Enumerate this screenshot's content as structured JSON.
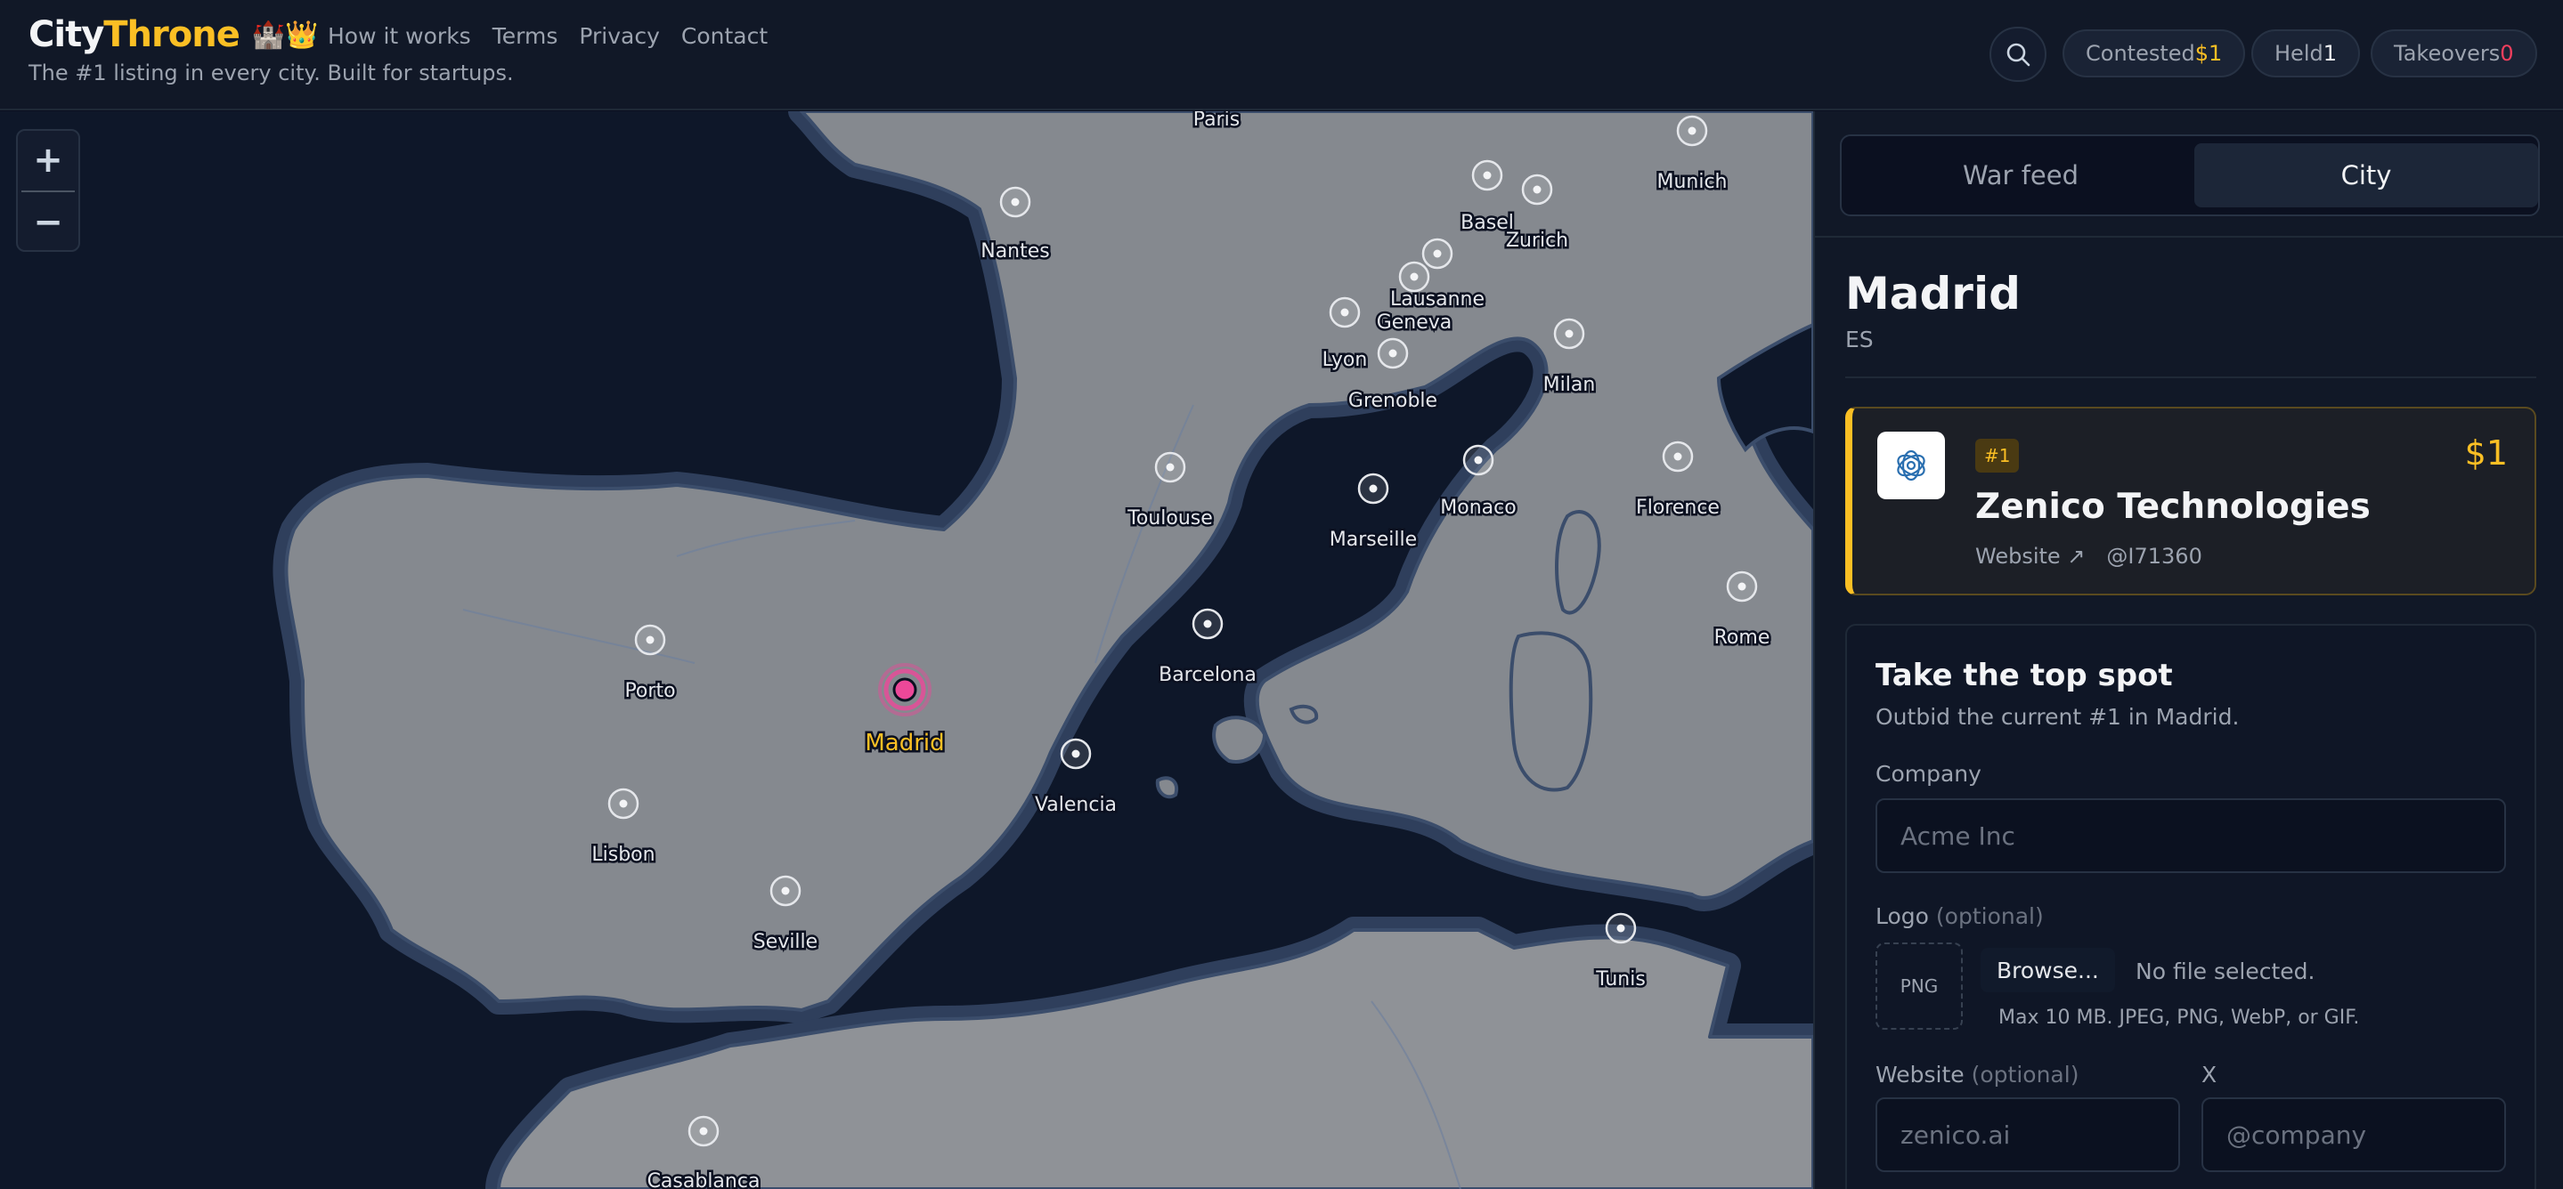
{
  "header": {
    "brand_city": "City",
    "brand_throne": "Throne",
    "brand_emoji": "🏰👑",
    "tagline": "The #1 listing in every city. Built for startups.",
    "nav": [
      "How it works",
      "Terms",
      "Privacy",
      "Contact"
    ],
    "search_icon": "search-icon",
    "stats": {
      "contested_label": "Contested",
      "contested_value": "$1",
      "held_label": "Held",
      "held_value": "1",
      "takeovers_label": "Takeovers",
      "takeovers_value": "0"
    }
  },
  "map": {
    "zoom_in": "+",
    "zoom_out": "−",
    "cities": [
      "Paris",
      "Nantes",
      "Munich",
      "Basel",
      "Zurich",
      "Lausanne",
      "Geneva",
      "Lyon",
      "Grenoble",
      "Milan",
      "Toulouse",
      "Monaco",
      "Marseille",
      "Florence",
      "Porto",
      "Madrid",
      "Barcelona",
      "Rome",
      "Valencia",
      "Lisbon",
      "Seville",
      "Tunis",
      "Casablanca"
    ],
    "selected_city": "Madrid",
    "colors": {
      "land": "#8a8d93",
      "sea": "#0e1729",
      "coast": "#3b4d6b",
      "selected": "#ec4899",
      "selected_label": "#fbbf24"
    }
  },
  "sidebar": {
    "tabs": [
      "War feed",
      "City"
    ],
    "active_tab": "City",
    "city_name": "Madrid",
    "country": "ES",
    "leader": {
      "rank": "#1",
      "price": "$1",
      "name": "Zenico Technologies",
      "website": "Website ↗",
      "handle": "@I71360",
      "logo_icon": "zenico-logo-icon"
    },
    "form": {
      "title": "Take the top spot",
      "subtitle": "Outbid the current #1 in Madrid.",
      "company_label": "Company",
      "company_placeholder": "Acme Inc",
      "logo_label": "Logo",
      "optional": "(optional)",
      "logo_format": "PNG",
      "browse": "Browse...",
      "no_file": "No file selected.",
      "file_hint": "Max 10 MB. JPEG, PNG, WebP, or GIF.",
      "website_label": "Website",
      "website_placeholder": "zenico.ai",
      "x_label": "X",
      "x_placeholder": "@company"
    }
  }
}
